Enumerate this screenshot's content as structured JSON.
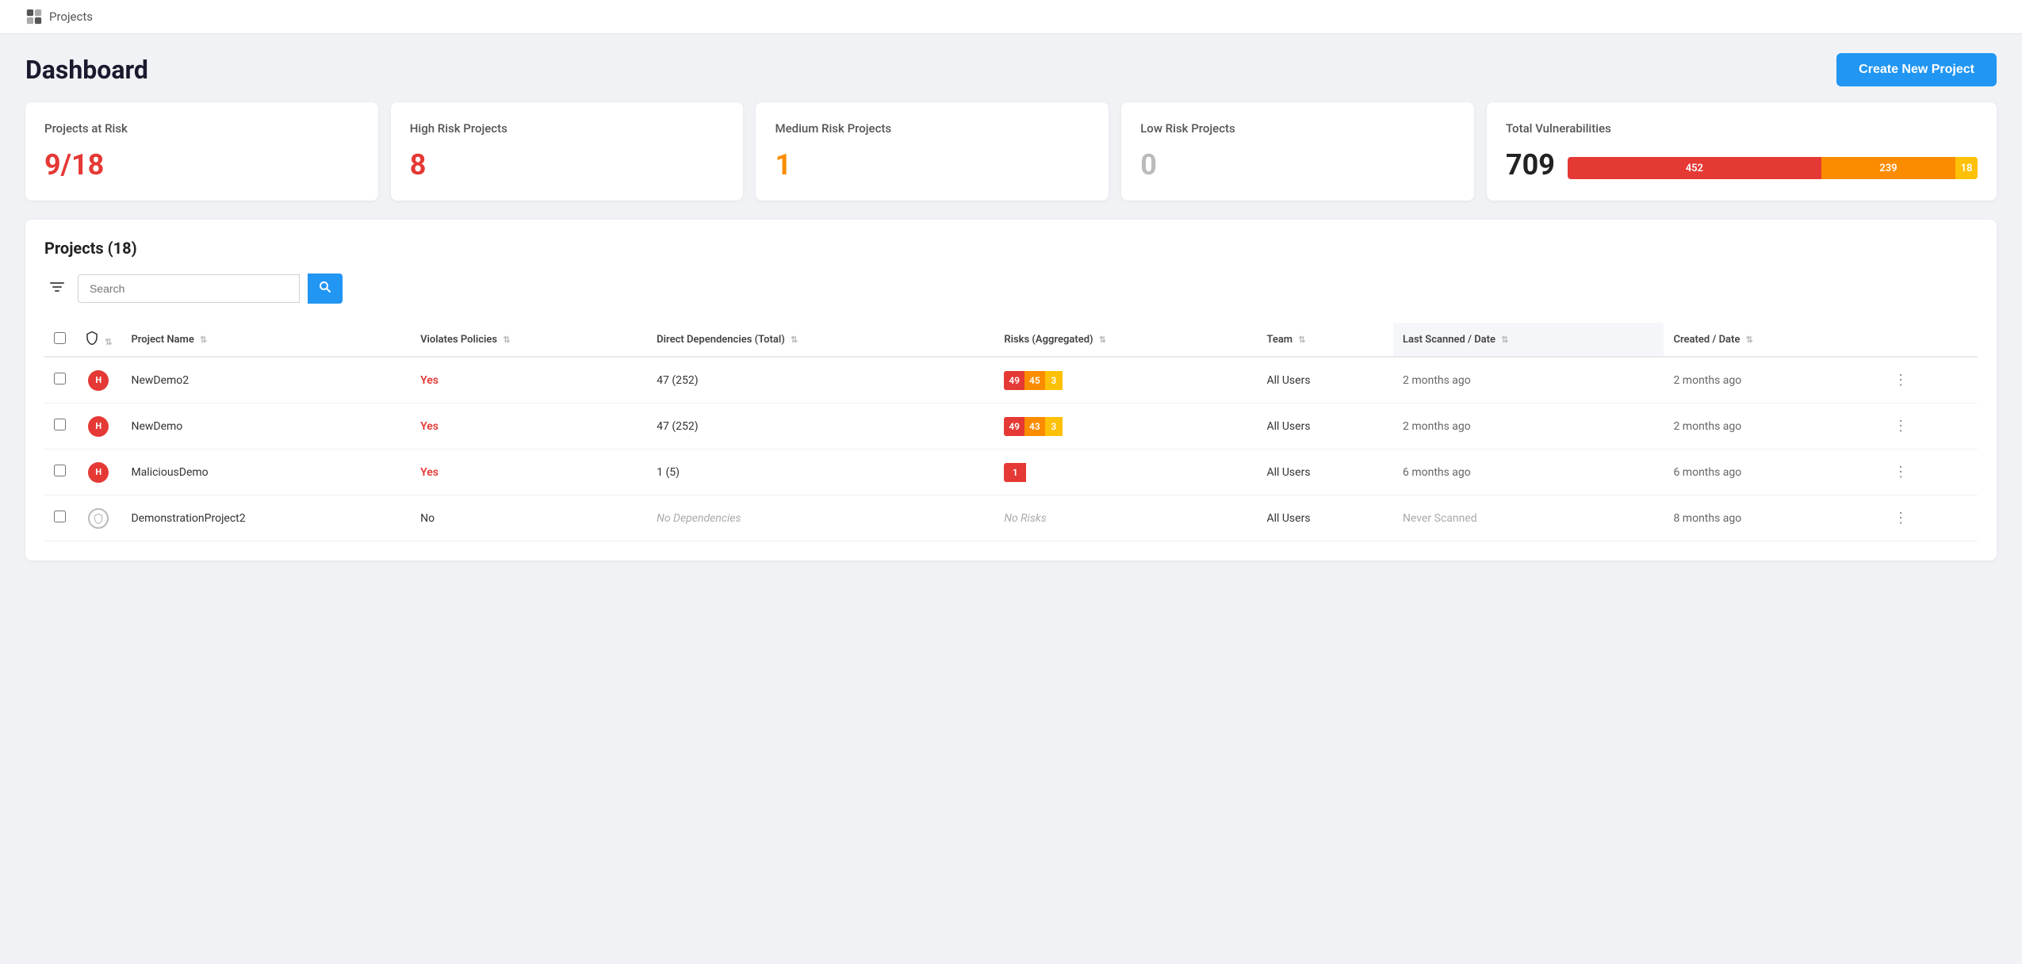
{
  "topbar": {
    "logo_text": "Projects"
  },
  "header": {
    "title": "Dashboard",
    "create_btn": "Create New Project"
  },
  "cards": [
    {
      "id": "projects-at-risk",
      "title": "Projects at Risk",
      "value": "9/18",
      "color": "red"
    },
    {
      "id": "high-risk",
      "title": "High Risk Projects",
      "value": "8",
      "color": "red"
    },
    {
      "id": "medium-risk",
      "title": "Medium Risk Projects",
      "value": "1",
      "color": "orange"
    },
    {
      "id": "low-risk",
      "title": "Low Risk Projects",
      "value": "0",
      "color": "gray"
    }
  ],
  "vuln_card": {
    "title": "Total Vulnerabilities",
    "total": "709",
    "segments": [
      {
        "label": "452",
        "pct": 63.7,
        "color": "red"
      },
      {
        "label": "239",
        "pct": 33.7,
        "color": "orange"
      },
      {
        "label": "18",
        "pct": 2.5,
        "color": "yellow"
      }
    ]
  },
  "projects_section": {
    "title": "Projects (18)",
    "search_placeholder": "Search",
    "search_btn_icon": "🔍",
    "columns": [
      "Project Name",
      "Violates Policies",
      "Direct Dependencies (Total)",
      "Risks (Aggregated)",
      "Team",
      "Last Scanned / Date",
      "Created / Date"
    ],
    "rows": [
      {
        "risk_level": "high",
        "name": "NewDemo2",
        "violates": "Yes",
        "deps": "47 (252)",
        "risks": [
          {
            "val": "49",
            "color": "red"
          },
          {
            "val": "45",
            "color": "orange"
          },
          {
            "val": "3",
            "color": "yellow"
          }
        ],
        "no_risks": false,
        "team": "All Users",
        "last_scanned": "2 months ago",
        "created": "2 months ago"
      },
      {
        "risk_level": "high",
        "name": "NewDemo",
        "violates": "Yes",
        "deps": "47 (252)",
        "risks": [
          {
            "val": "49",
            "color": "red"
          },
          {
            "val": "43",
            "color": "orange"
          },
          {
            "val": "3",
            "color": "yellow"
          }
        ],
        "no_risks": false,
        "team": "All Users",
        "last_scanned": "2 months ago",
        "created": "2 months ago"
      },
      {
        "risk_level": "high",
        "name": "MaliciousDemo",
        "violates": "Yes",
        "deps": "1 (5)",
        "risks": [
          {
            "val": "1",
            "color": "red"
          }
        ],
        "no_risks": false,
        "team": "All Users",
        "last_scanned": "6 months ago",
        "created": "6 months ago"
      },
      {
        "risk_level": "none",
        "name": "DemonstrationProject2",
        "violates": "No",
        "deps": "No Dependencies",
        "risks": [],
        "no_risks": true,
        "team": "All Users",
        "last_scanned": "Never Scanned",
        "created": "8 months ago"
      }
    ]
  }
}
